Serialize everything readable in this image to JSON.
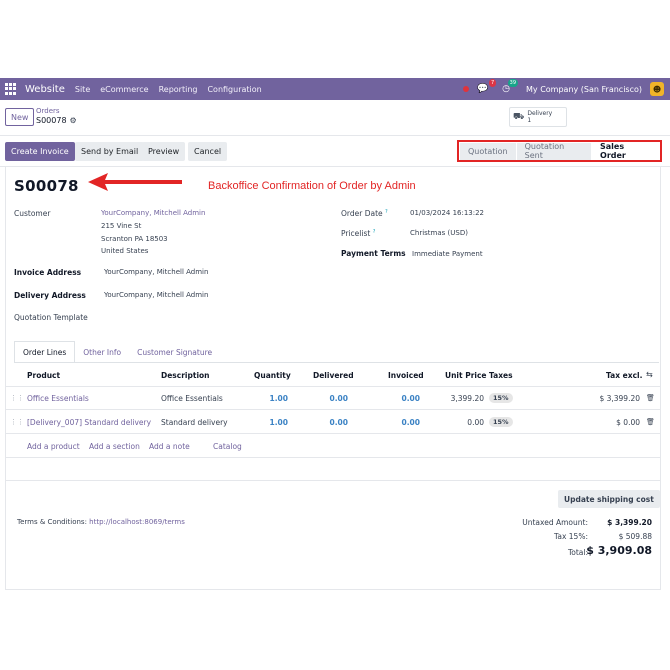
{
  "navbar": {
    "brand": "Website",
    "menu": [
      "Site",
      "eCommerce",
      "Reporting",
      "Configuration"
    ],
    "chat_badge": "7",
    "activity_badge": "39",
    "company": "My Company (San Francisco)"
  },
  "control": {
    "new_label": "New",
    "breadcrumb_parent": "Orders",
    "breadcrumb_current": "S00078",
    "delivery_label": "Delivery",
    "delivery_count": "1"
  },
  "actions": {
    "create_invoice": "Create Invoice",
    "send_email": "Send by Email",
    "preview": "Preview",
    "cancel": "Cancel"
  },
  "status": {
    "stages": [
      "Quotation",
      "Quotation Sent",
      "Sales Order"
    ],
    "active": "Sales Order"
  },
  "order": {
    "name": "S00078",
    "annotation": "Backoffice Confirmation of Order by Admin",
    "customer_label": "Customer",
    "customer_name": "YourCompany, Mitchell Admin",
    "customer_street": "215 Vine St",
    "customer_city": "Scranton PA 18503",
    "customer_country": "United States",
    "invoice_address_label": "Invoice Address",
    "invoice_address": "YourCompany, Mitchell Admin",
    "delivery_address_label": "Delivery Address",
    "delivery_address": "YourCompany, Mitchell Admin",
    "quotation_template_label": "Quotation Template",
    "order_date_label": "Order Date",
    "order_date": "01/03/2024 16:13:22",
    "pricelist_label": "Pricelist",
    "pricelist": "Christmas (USD)",
    "payment_terms_label": "Payment Terms",
    "payment_terms": "Immediate Payment",
    "help_mark": "?"
  },
  "tabs": [
    "Order Lines",
    "Other Info",
    "Customer Signature"
  ],
  "table": {
    "headers": {
      "product": "Product",
      "description": "Description",
      "quantity": "Quantity",
      "delivered": "Delivered",
      "invoiced": "Invoiced",
      "unit_price": "Unit Price",
      "taxes": "Taxes",
      "tax_excl": "Tax excl."
    },
    "rows": [
      {
        "product": "Office Essentials",
        "description": "Office Essentials",
        "quantity": "1.00",
        "delivered": "0.00",
        "invoiced": "0.00",
        "unit_price": "3,399.20",
        "taxes": "15%",
        "subtotal": "$ 3,399.20"
      },
      {
        "product": "[Delivery_007] Standard delivery",
        "description": "Standard delivery",
        "quantity": "1.00",
        "delivered": "0.00",
        "invoiced": "0.00",
        "unit_price": "0.00",
        "taxes": "15%",
        "subtotal": "$ 0.00"
      }
    ],
    "add_links": [
      "Add a product",
      "Add a section",
      "Add a note",
      "Catalog"
    ]
  },
  "footer": {
    "update_shipping": "Update shipping cost",
    "terms_label": "Terms & Conditions:",
    "terms_link": "http://localhost:8069/terms",
    "untaxed_label": "Untaxed Amount:",
    "untaxed_value": "$ 3,399.20",
    "tax_label": "Tax 15%:",
    "tax_value": "$ 509.88",
    "total_label": "Total:",
    "total_value": "$ 3,909.08"
  }
}
